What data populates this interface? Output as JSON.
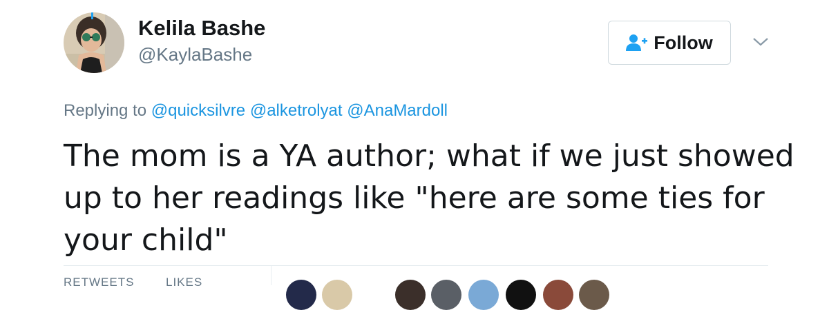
{
  "user": {
    "display_name": "Kelila Bashe",
    "handle": "@KaylaBashe"
  },
  "follow_button": {
    "label": "Follow",
    "icon": "add-user-icon"
  },
  "menu": {
    "icon": "chevron-down-icon"
  },
  "reply_context": {
    "prefix": "Replying to",
    "mentions": [
      "@quicksilvre",
      "@alketrolyat",
      "@AnaMardoll"
    ]
  },
  "tweet": {
    "text": "The mom is a YA author; what if we just showed up to her readings like \"here are some ties for your child\""
  },
  "stats": {
    "retweets_label": "RETWEETS",
    "likes_label": "LIKES"
  },
  "colors": {
    "link": "#1b95e0",
    "text": "#14171a",
    "secondary": "#657786",
    "border": "#e6ecf0"
  }
}
